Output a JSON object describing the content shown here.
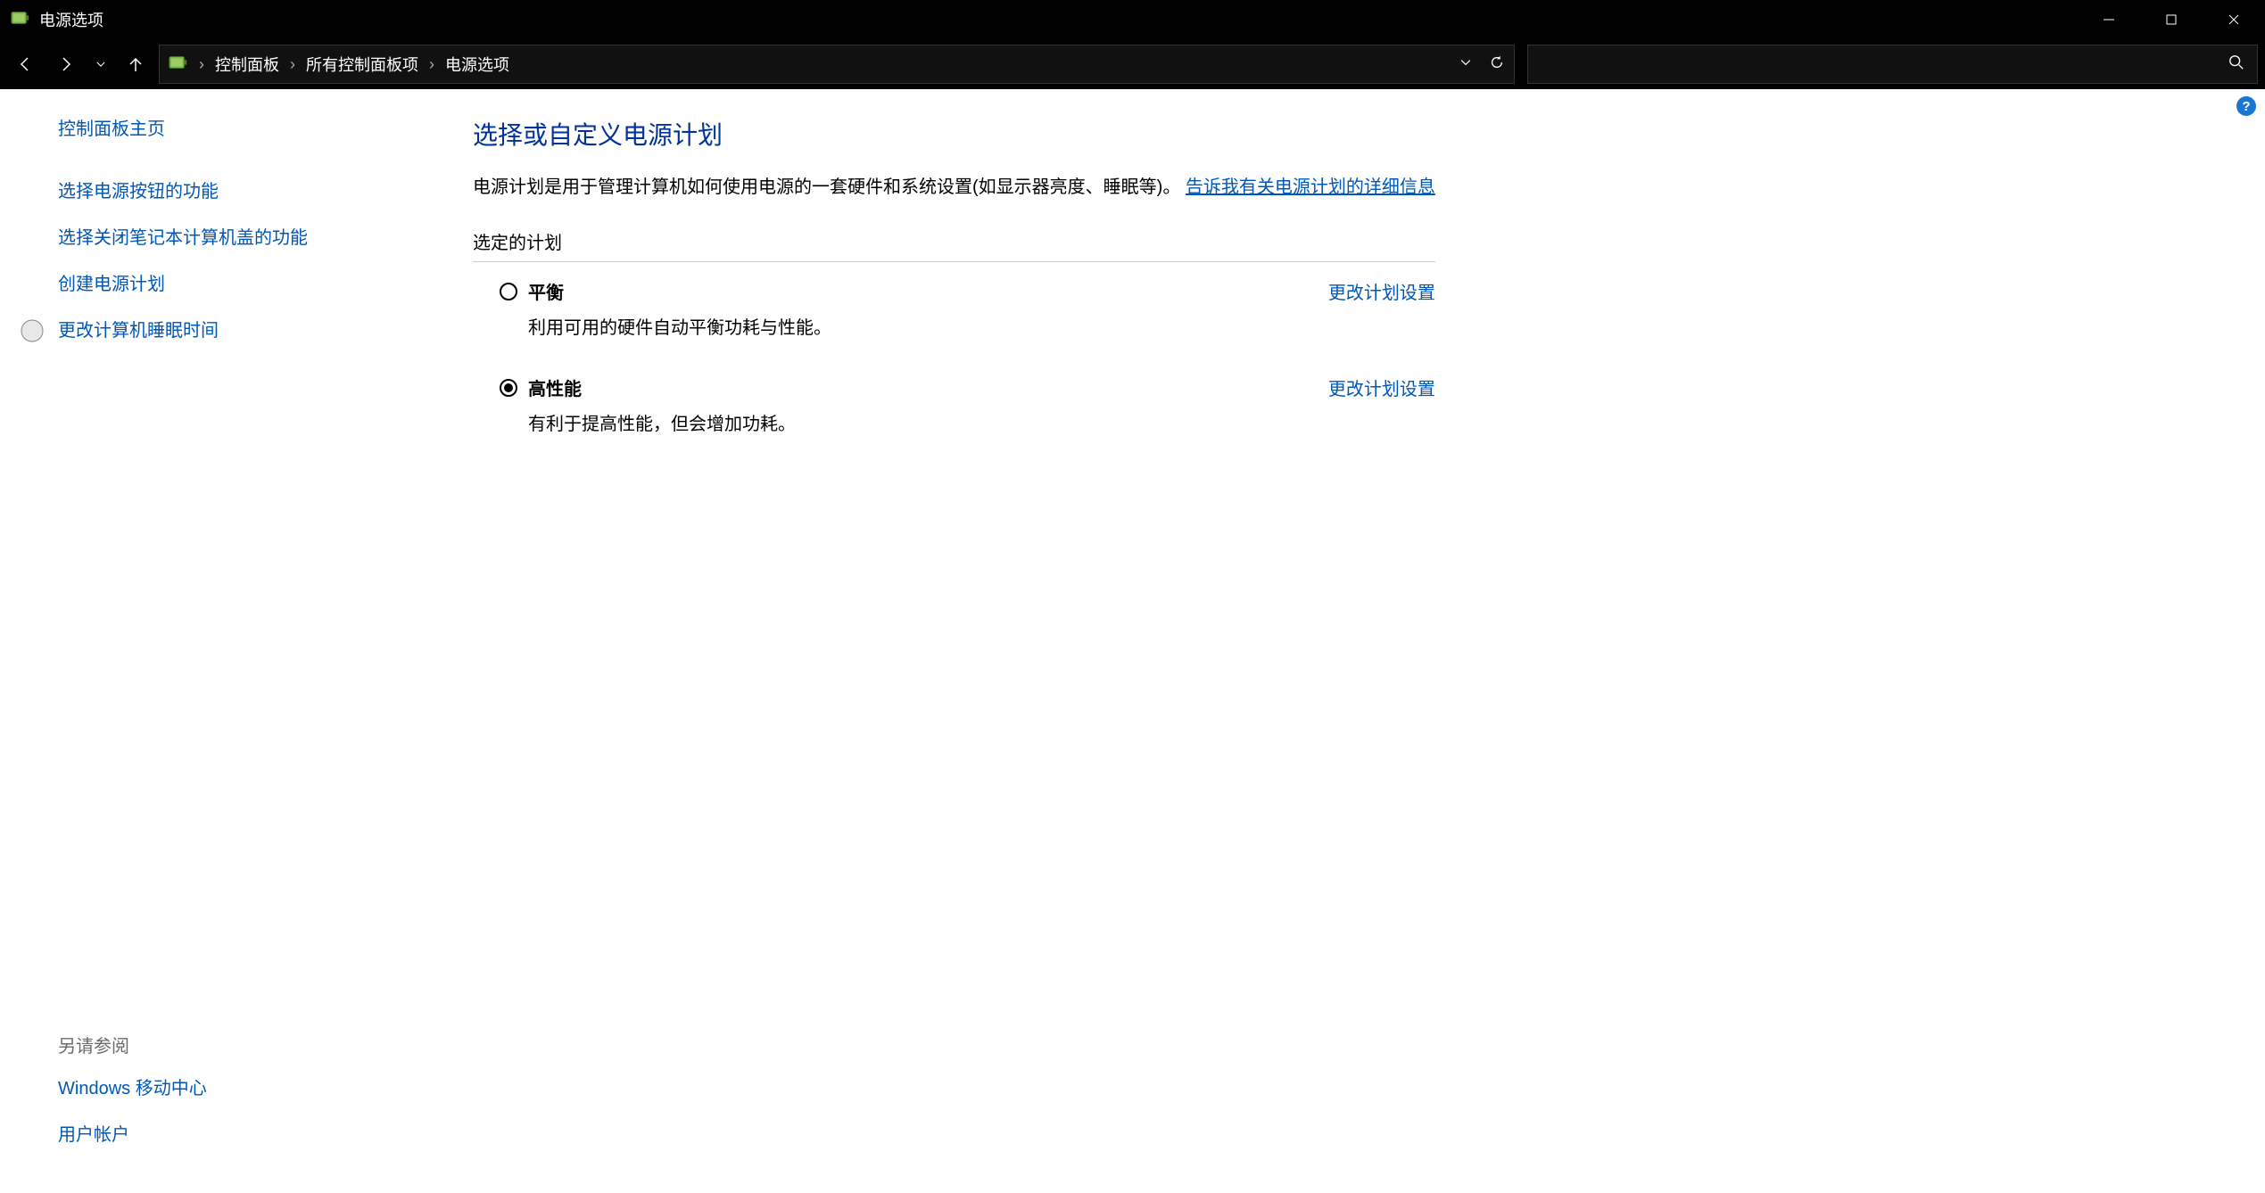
{
  "window": {
    "title": "电源选项"
  },
  "breadcrumb": {
    "items": [
      "控制面板",
      "所有控制面板项",
      "电源选项"
    ]
  },
  "sidebar": {
    "home": "控制面板主页",
    "links": [
      "选择电源按钮的功能",
      "选择关闭笔记本计算机盖的功能",
      "创建电源计划",
      "更改计算机睡眠时间"
    ],
    "see_also_label": "另请参阅",
    "see_also": [
      "Windows 移动中心",
      "用户帐户"
    ]
  },
  "main": {
    "title": "选择或自定义电源计划",
    "desc_prefix": "电源计划是用于管理计算机如何使用电源的一套硬件和系统设置(如显示器亮度、睡眠等)。",
    "desc_link": "告诉我有关电源计划的详细信息",
    "section_label": "选定的计划",
    "plans": [
      {
        "name": "平衡",
        "desc": "利用可用的硬件自动平衡功耗与性能。",
        "selected": false,
        "change_label": "更改计划设置"
      },
      {
        "name": "高性能",
        "desc": "有利于提高性能，但会增加功耗。",
        "selected": true,
        "change_label": "更改计划设置"
      }
    ]
  }
}
